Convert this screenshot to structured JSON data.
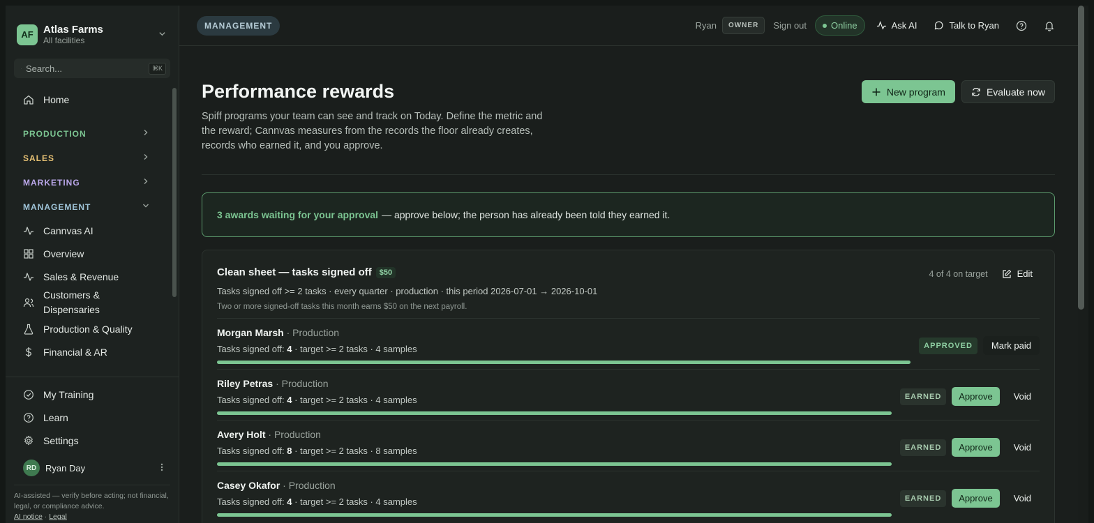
{
  "org": {
    "badge": "AF",
    "name": "Atlas Farms",
    "subtitle": "All facilities"
  },
  "search": {
    "placeholder": "Search...",
    "shortcut": "⌘K"
  },
  "sidebar": {
    "home": "Home",
    "sections": {
      "production": "PRODUCTION",
      "sales": "SALES",
      "marketing": "MARKETING",
      "management": "MANAGEMENT"
    },
    "management_items": [
      "Cannvas AI",
      "Overview",
      "Sales & Revenue",
      "Customers & Dispensaries",
      "Production & Quality",
      "Financial & AR"
    ],
    "bottom": {
      "training": "My Training",
      "learn": "Learn",
      "settings": "Settings"
    },
    "user": {
      "initials": "RD",
      "name": "Ryan Day"
    },
    "disclaimer": "AI-assisted — verify before acting; not financial, legal, or compliance advice.",
    "links": {
      "ai_notice": "AI notice",
      "sep": "·",
      "legal": "Legal"
    },
    "colors": {
      "production": "#7cc592",
      "sales": "#e5c073",
      "marketing": "#b9a6e8",
      "management": "#9fc4d8"
    }
  },
  "topbar": {
    "section": "MANAGEMENT",
    "user": "Ryan",
    "role": "OWNER",
    "signout": "Sign out",
    "status": "Online",
    "ask_ai": "Ask AI",
    "talk": "Talk to Ryan"
  },
  "page": {
    "title": "Performance rewards",
    "description": "Spiff programs your team can see and track on Today. Define the metric and the reward; Cannvas measures from the records the floor already creates, records who earned it, and you approve.",
    "new_program": "New program",
    "evaluate": "Evaluate now"
  },
  "alert": {
    "strong": "3 awards waiting for your approval",
    "rest": "— approve below; the person has already been told they earned it."
  },
  "program": {
    "title": "Clean sheet — tasks signed off",
    "amount": "$50",
    "on_target": "4 of 4 on target",
    "edit": "Edit",
    "meta": "Tasks signed off >= 2 tasks · every quarter · production · this period 2026-07-01 → 2026-10-01",
    "note": "Two or more signed-off tasks this month earns $50 on the next payroll.",
    "rows": [
      {
        "name": "Morgan Marsh",
        "dept": "· Production",
        "metric_label": "Tasks signed off: ",
        "value": "4",
        "metric_rest": " · target >= 2 tasks · 4 samples",
        "status": "APPROVED",
        "action": "Mark paid",
        "progress": 1.0
      },
      {
        "name": "Riley Petras",
        "dept": "· Production",
        "metric_label": "Tasks signed off: ",
        "value": "4",
        "metric_rest": " · target >= 2 tasks · 4 samples",
        "status": "EARNED",
        "approve": "Approve",
        "void": "Void",
        "progress": 1.0
      },
      {
        "name": "Avery Holt",
        "dept": "· Production",
        "metric_label": "Tasks signed off: ",
        "value": "8",
        "metric_rest": " · target >= 2 tasks · 8 samples",
        "status": "EARNED",
        "approve": "Approve",
        "void": "Void",
        "progress": 1.0
      },
      {
        "name": "Casey Okafor",
        "dept": "· Production",
        "metric_label": "Tasks signed off: ",
        "value": "4",
        "metric_rest": " · target >= 2 tasks · 4 samples",
        "status": "EARNED",
        "approve": "Approve",
        "void": "Void",
        "progress": 1.0
      }
    ]
  }
}
